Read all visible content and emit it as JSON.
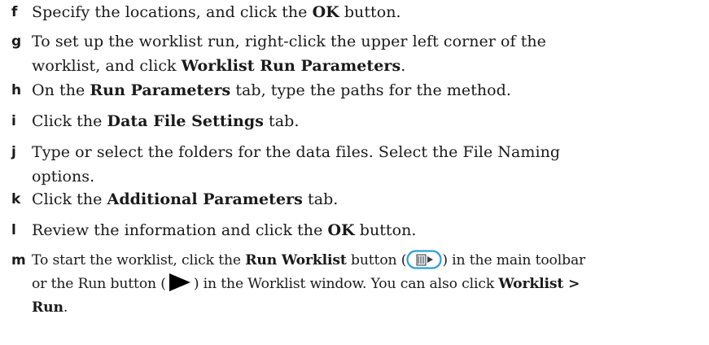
{
  "steps": [
    {
      "letter": "f",
      "parts": [
        {
          "t": "Specify the locations, and click the "
        },
        {
          "t": "OK",
          "b": true
        },
        {
          "t": " button."
        }
      ]
    },
    {
      "letter": "g",
      "lines": [
        [
          {
            "t": "To set up the worklist run, right-click the upper left corner of the"
          }
        ],
        [
          {
            "t": "worklist, and click "
          },
          {
            "t": "Worklist Run Parameters",
            "b": true
          },
          {
            "t": "."
          }
        ]
      ]
    },
    {
      "letter": "h",
      "parts": [
        {
          "t": "On the "
        },
        {
          "t": "Run Parameters",
          "b": true
        },
        {
          "t": " tab, type the paths for the method."
        }
      ]
    },
    {
      "letter": "i",
      "parts": [
        {
          "t": "Click the "
        },
        {
          "t": "Data File Settings",
          "b": true
        },
        {
          "t": " tab."
        }
      ]
    },
    {
      "letter": "j",
      "lines": [
        [
          {
            "t": "Type or select the folders for the data files. Select the File Naming"
          }
        ],
        [
          {
            "t": "options."
          }
        ]
      ]
    },
    {
      "letter": "k",
      "parts": [
        {
          "t": "Click the "
        },
        {
          "t": "Additional Parameters",
          "b": true
        },
        {
          "t": " tab."
        }
      ]
    },
    {
      "letter": "l",
      "parts": [
        {
          "t": "Review the information and click the "
        },
        {
          "t": "OK",
          "b": true
        },
        {
          "t": " button."
        }
      ]
    },
    {
      "letter": "m",
      "tight": true,
      "lines": [
        [
          {
            "t": "To start the worklist, click the "
          },
          {
            "t": "Run Worklist",
            "b": true
          },
          {
            "t": " button ("
          },
          {
            "icon": "run-worklist-icon"
          },
          {
            "t": ") in the main toolbar"
          }
        ],
        [
          {
            "t": "or the Run button ("
          },
          {
            "icon": "run-icon"
          },
          {
            "t": ") in the Worklist window. You can also click "
          },
          {
            "t": "Worklist >",
            "b": true
          }
        ],
        [
          {
            "t": "Run",
            "b": true
          },
          {
            "t": "."
          }
        ]
      ]
    }
  ],
  "icons": {
    "run_worklist": {
      "name": "run-worklist-icon",
      "accent": "#2a9fd6",
      "fill": "#ffffff",
      "glyph": "#3a3a3a"
    },
    "run": {
      "name": "run-icon",
      "glyph": "#000000"
    }
  }
}
